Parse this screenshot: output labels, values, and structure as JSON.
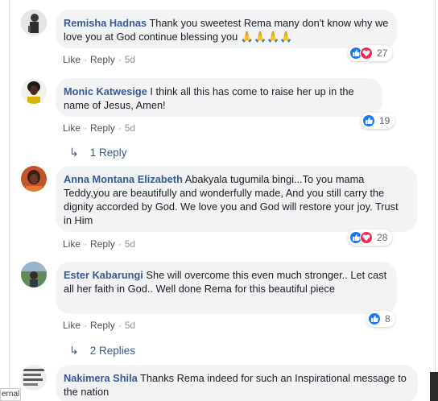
{
  "actions": {
    "like": "Like",
    "reply": "Reply",
    "sep": "·"
  },
  "comments": [
    {
      "author": "Remisha Hadnas",
      "text": "Thank you sweetest Rema many don't know why we love you at God continue blessing you",
      "emoji": "🙏🙏🙏🙏",
      "time": "5d",
      "reactions": {
        "types": [
          "like",
          "love"
        ],
        "count": "27"
      }
    },
    {
      "author": "Monic Katwesige",
      "text": "I think all this has come to raise her up in the name of Jesus, Amen!",
      "time": "5d",
      "reactions": {
        "types": [
          "like"
        ],
        "count": "19"
      },
      "replies": "1 Reply"
    },
    {
      "author": "Anna Montana Elizabeth",
      "text": "Abakyala tugumila bingi...To you mama Teddy,you are beautifully and wonderfully made, And you still carry the dignity accorded by God. We love you and God will restore your joy. Trust in Him",
      "time": "5d",
      "reactions": {
        "types": [
          "like",
          "love"
        ],
        "count": "28"
      }
    },
    {
      "author": "Ester Kabarungi",
      "text": "She will overcome this even much stronger.. Let cast all her faith in God.. Well done Rema for this beautiful piece",
      "time": "5d",
      "reactions": {
        "types": [
          "like"
        ],
        "count": "8"
      },
      "replies": "2 Replies"
    },
    {
      "author": "Nakimera Shila",
      "text": "Thanks Rema indeed for such an Inspirational message to the nation"
    }
  ],
  "edge_label": "ernal",
  "colors": {
    "link": "#385898",
    "bubble": "#f2f3f5",
    "like": "#1877f2",
    "love": "#f0284a"
  }
}
